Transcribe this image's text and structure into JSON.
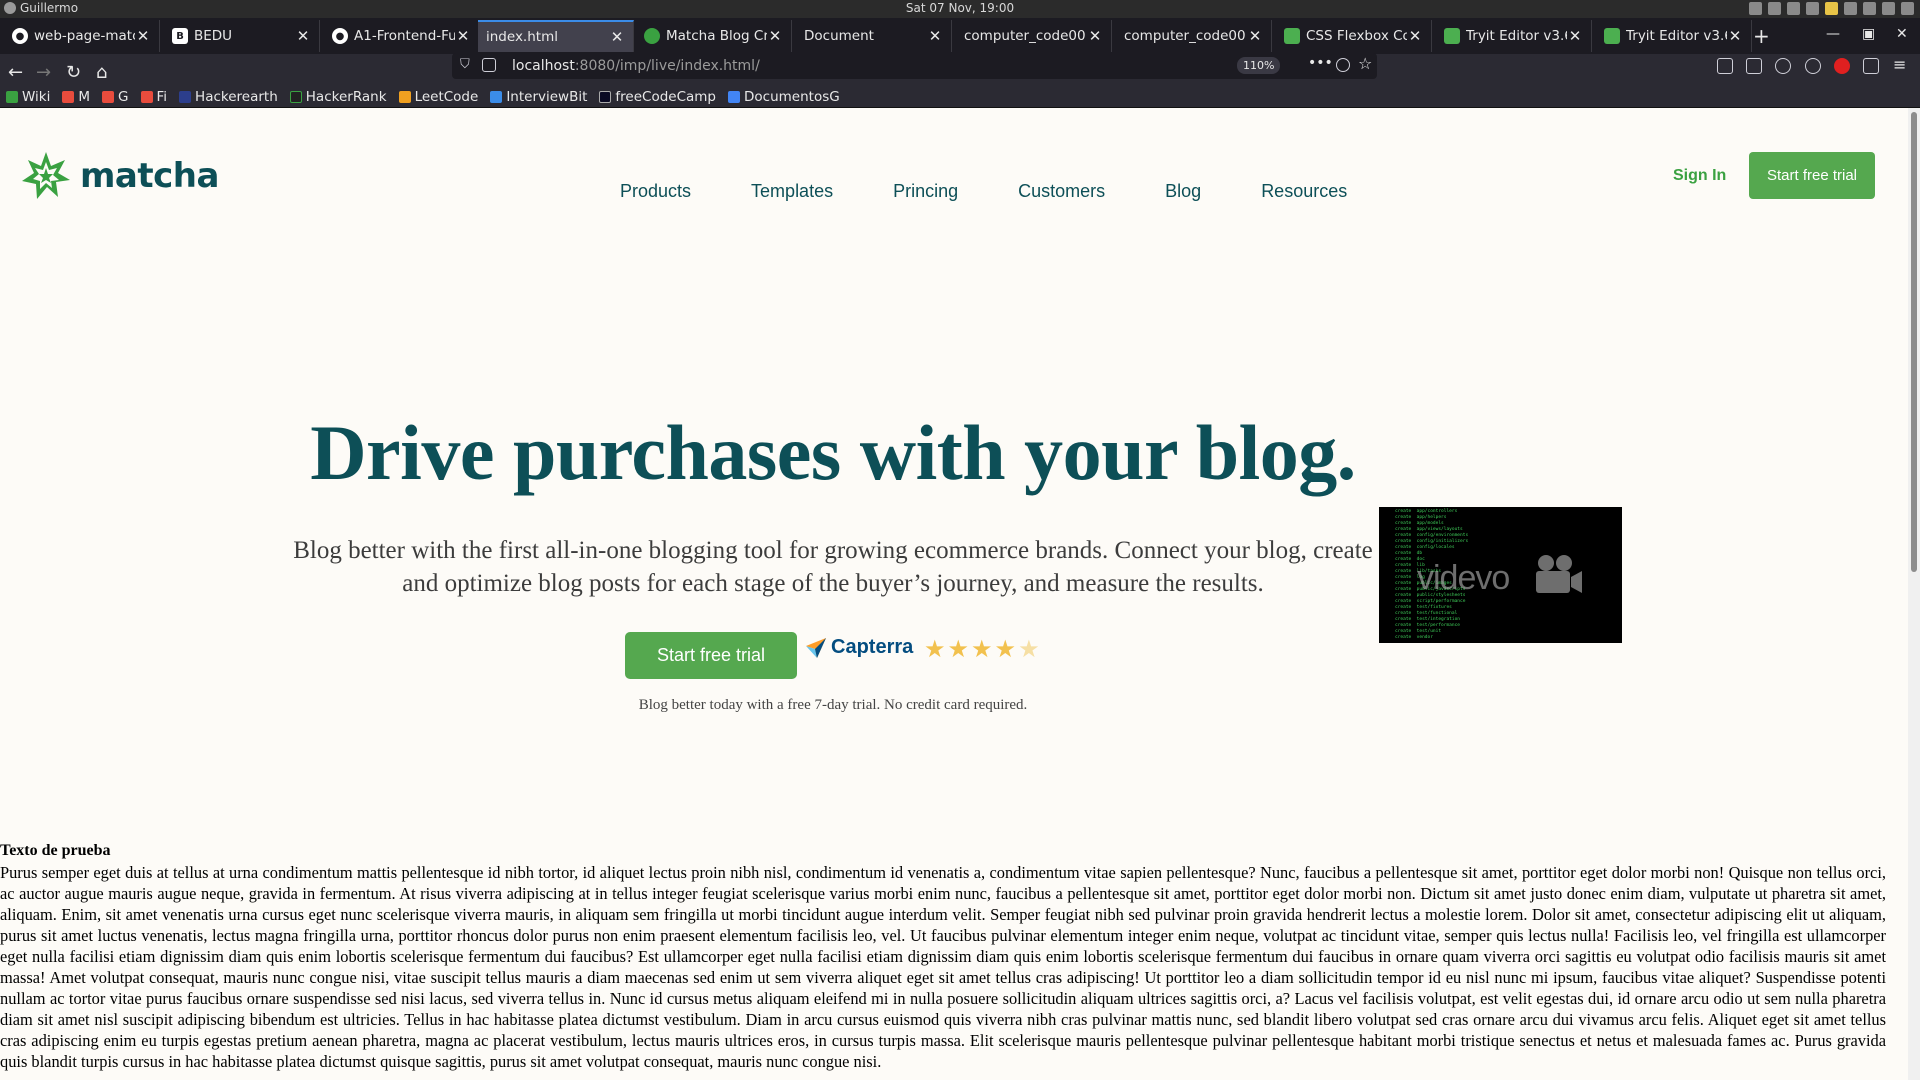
{
  "os": {
    "user": "Guillermo",
    "clock": "Sat 07 Nov, 19:00"
  },
  "tabs": [
    {
      "title": "web-page-matc",
      "favicon": "github-icon",
      "color": "#ffffff"
    },
    {
      "title": "BEDU",
      "favicon": "bedu-icon",
      "color": "#ffffff"
    },
    {
      "title": "A1-Frontend-Fu",
      "favicon": "github-icon",
      "color": "#ffffff"
    },
    {
      "title": "index.html",
      "favicon": "",
      "color": ""
    },
    {
      "title": "Matcha Blog Cr",
      "favicon": "matcha-icon",
      "color": "#3aa141"
    },
    {
      "title": "Document",
      "favicon": "",
      "color": ""
    },
    {
      "title": "computer_code00",
      "favicon": "",
      "color": ""
    },
    {
      "title": "computer_code00",
      "favicon": "",
      "color": ""
    },
    {
      "title": "CSS Flexbox Co",
      "favicon": "tryit-icon",
      "color": "#4caf50"
    },
    {
      "title": "Tryit Editor v3.6",
      "favicon": "tryit-icon",
      "color": "#4caf50"
    },
    {
      "title": "Tryit Editor v3.6",
      "favicon": "tryit-icon",
      "color": "#4caf50"
    }
  ],
  "urlbar": {
    "host": "localhost",
    "path": ":8080/imp/live/index.html/",
    "zoom": "110%"
  },
  "bookmarks": [
    {
      "label": "Wiki",
      "color": "#3aa141"
    },
    {
      "label": "M",
      "color": "#e84c3d"
    },
    {
      "label": "G",
      "color": "#e84c3d"
    },
    {
      "label": "Fi",
      "color": "#e84c3d"
    },
    {
      "label": "Hackerearth",
      "color": "#2c3e8c"
    },
    {
      "label": "HackerRank",
      "color": "#222"
    },
    {
      "label": "LeetCode",
      "color": "#f0a020"
    },
    {
      "label": "InterviewBit",
      "color": "#3b8ce8"
    },
    {
      "label": "freeCodeCamp",
      "color": "#0a0a23"
    },
    {
      "label": "DocumentosG",
      "color": "#4285f4"
    }
  ],
  "site": {
    "brand": "matcha",
    "nav": [
      "Products",
      "Templates",
      "Princing",
      "Customers",
      "Blog",
      "Resources"
    ],
    "signin": "Sign In",
    "cta_top": "Start free trial",
    "hero_title": "Drive purchases with your blog.",
    "hero_sub": "Blog better with the first all-in-one blogging tool for growing ecommerce brands. Connect your blog, create and optimize blog posts for each stage of the buyer’s journey, and measure the results.",
    "cta_hero": "Start free trial",
    "capterra": "Capterra",
    "rating": 4.5,
    "note": "Blog better today with a free 7-day trial. No credit card required.",
    "video_brand": "videvo"
  },
  "test": {
    "heading": "Texto de prueba",
    "body": "Purus semper eget duis at tellus at urna condimentum mattis pellentesque id nibh tortor, id aliquet lectus proin nibh nisl, condimentum id venenatis a, condimentum vitae sapien pellentesque? Nunc, faucibus a pellentesque sit amet, porttitor eget dolor morbi non! Quisque non tellus orci, ac auctor augue mauris augue neque, gravida in fermentum. At risus viverra adipiscing at in tellus integer feugiat scelerisque varius morbi enim nunc, faucibus a pellentesque sit amet, porttitor eget dolor morbi non. Dictum sit amet justo donec enim diam, vulputate ut pharetra sit amet, aliquam. Enim, sit amet venenatis urna cursus eget nunc scelerisque viverra mauris, in aliquam sem fringilla ut morbi tincidunt augue interdum velit. Semper feugiat nibh sed pulvinar proin gravida hendrerit lectus a molestie lorem. Dolor sit amet, consectetur adipiscing elit ut aliquam, purus sit amet luctus venenatis, lectus magna fringilla urna, porttitor rhoncus dolor purus non enim praesent elementum facilisis leo, vel. Ut faucibus pulvinar elementum integer enim neque, volutpat ac tincidunt vitae, semper quis lectus nulla! Facilisis leo, vel fringilla est ullamcorper eget nulla facilisi etiam dignissim diam quis enim lobortis scelerisque fermentum dui faucibus? Est ullamcorper eget nulla facilisi etiam dignissim diam quis enim lobortis scelerisque fermentum dui faucibus in ornare quam viverra orci sagittis eu volutpat odio facilisis mauris sit amet massa! Amet volutpat consequat, mauris nunc congue nisi, vitae suscipit tellus mauris a diam maecenas sed enim ut sem viverra aliquet eget sit amet tellus cras adipiscing! Ut porttitor leo a diam sollicitudin tempor id eu nisl nunc mi ipsum, faucibus vitae aliquet? Suspendisse potenti nullam ac tortor vitae purus faucibus ornare suspendisse sed nisi lacus, sed viverra tellus in. Nunc id cursus metus aliquam eleifend mi in nulla posuere sollicitudin aliquam ultrices sagittis orci, a? Lacus vel facilisis volutpat, est velit egestas dui, id ornare arcu odio ut sem nulla pharetra diam sit amet nisl suscipit adipiscing bibendum est ultricies. Tellus in hac habitasse platea dictumst vestibulum. Diam in arcu cursus euismod quis viverra nibh cras pulvinar mattis nunc, sed blandit libero volutpat sed cras ornare arcu dui vivamus arcu felis. Aliquet eget sit amet tellus cras adipiscing enim eu turpis egestas pretium aenean pharetra, magna ac placerat vestibulum, lectus mauris ultrices eros, in cursus turpis massa. Elit scelerisque mauris pellentesque pulvinar pellentesque habitant morbi tristique senectus et netus et malesuada fames ac. Purus gravida quis blandit turpis cursus in hac habitasse platea dictumst quisque sagittis, purus sit amet volutpat consequat, mauris nunc congue nisi."
  },
  "colors": {
    "brand": "#0d4f57",
    "accent": "#55a84f",
    "page_bg": "#fdfbf7"
  }
}
